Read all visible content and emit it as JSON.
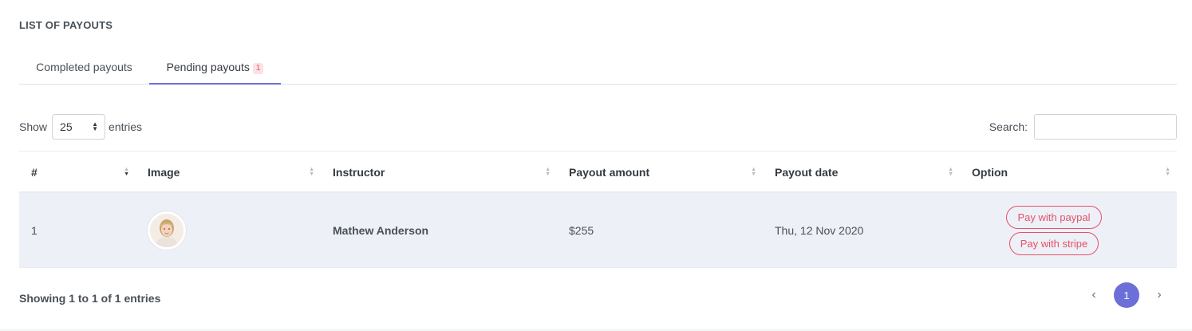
{
  "card": {
    "title": "LIST OF PAYOUTS"
  },
  "tabs": [
    {
      "label": "Completed payouts",
      "active": false
    },
    {
      "label": "Pending payouts",
      "badge": "1",
      "active": true
    }
  ],
  "length": {
    "show_label": "Show",
    "value": "25",
    "entries_label": "entries"
  },
  "search": {
    "label": "Search:",
    "value": ""
  },
  "table": {
    "columns": [
      "#",
      "Image",
      "Instructor",
      "Payout amount",
      "Payout date",
      "Option"
    ],
    "rows": [
      {
        "index": "1",
        "instructor": "Mathew Anderson",
        "amount": "$255",
        "date": "Thu, 12 Nov 2020",
        "options": [
          "Pay with paypal",
          "Pay with stripe"
        ]
      }
    ]
  },
  "footer": {
    "info": "Showing 1 to 1 of 1 entries"
  },
  "pagination": {
    "prev": "‹",
    "current": "1",
    "next": "›"
  },
  "colors": {
    "accent": "#6c6fd8",
    "danger": "#e5516a",
    "row_bg": "#edf0f7"
  }
}
